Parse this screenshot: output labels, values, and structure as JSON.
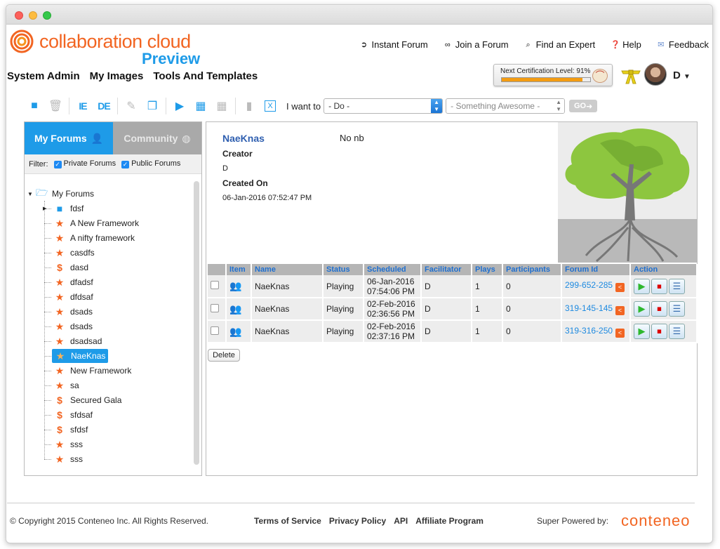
{
  "brand": {
    "name": "collaboration cloud",
    "sub": "Preview"
  },
  "topnav": [
    {
      "label": "Instant Forum",
      "icon": "play-circle-icon"
    },
    {
      "label": "Join a Forum",
      "icon": "link-icon"
    },
    {
      "label": "Find an Expert",
      "icon": "search-icon"
    },
    {
      "label": "Help",
      "icon": "help-icon"
    },
    {
      "label": "Feedback",
      "icon": "envelope-icon"
    }
  ],
  "mainmenu": [
    "System Admin",
    "My Images",
    "Tools And Templates"
  ],
  "certification": {
    "label": "Next Certification Level: 91%",
    "progress": 0.91
  },
  "user": {
    "name": "D"
  },
  "toolbar": {
    "ie": "IE",
    "de": "DE",
    "iwant_label": "I want to",
    "do_select": "- Do -",
    "something_select": "- Something Awesome -",
    "go": "GO"
  },
  "left": {
    "tab_my": "My Forums",
    "tab_community": "Community",
    "filter_label": "Filter:",
    "filter_private": "Private Forums",
    "filter_public": "Public Forums",
    "root": "My Forums",
    "items": [
      {
        "label": "fdsf",
        "type": "folder"
      },
      {
        "label": "A New Framework",
        "type": "star"
      },
      {
        "label": "A nifty framework",
        "type": "star"
      },
      {
        "label": "casdfs",
        "type": "star"
      },
      {
        "label": "dasd",
        "type": "dollar"
      },
      {
        "label": "dfadsf",
        "type": "star"
      },
      {
        "label": "dfdsaf",
        "type": "star"
      },
      {
        "label": "dsads",
        "type": "star"
      },
      {
        "label": "dsads",
        "type": "star"
      },
      {
        "label": "dsadsad",
        "type": "star"
      },
      {
        "label": "NaeKnas",
        "type": "star",
        "selected": true
      },
      {
        "label": "New Framework",
        "type": "star"
      },
      {
        "label": "sa",
        "type": "star"
      },
      {
        "label": "Secured Gala",
        "type": "dollar"
      },
      {
        "label": "sfdsaf",
        "type": "dollar"
      },
      {
        "label": "sfdsf",
        "type": "dollar"
      },
      {
        "label": "sss",
        "type": "star"
      },
      {
        "label": "sss",
        "type": "star"
      }
    ]
  },
  "detail": {
    "title": "NaeKnas",
    "description": "No nb",
    "creator_label": "Creator",
    "creator": "D",
    "created_label": "Created On",
    "created": "06-Jan-2016 07:52:47 PM"
  },
  "table": {
    "columns": [
      "",
      "Item",
      "Name",
      "Status",
      "Scheduled",
      "Facilitator",
      "Plays",
      "Participants",
      "Forum Id",
      "Action"
    ],
    "rows": [
      {
        "name": "NaeKnas",
        "status": "Playing",
        "date": "06-Jan-2016",
        "time": "07:54:06 PM",
        "facilitator": "D",
        "plays": "1",
        "participants": "0",
        "forum_id": "299-652-285"
      },
      {
        "name": "NaeKnas",
        "status": "Playing",
        "date": "02-Feb-2016",
        "time": "02:36:56 PM",
        "facilitator": "D",
        "plays": "1",
        "participants": "0",
        "forum_id": "319-145-145"
      },
      {
        "name": "NaeKnas",
        "status": "Playing",
        "date": "02-Feb-2016",
        "time": "02:37:16 PM",
        "facilitator": "D",
        "plays": "1",
        "participants": "0",
        "forum_id": "319-316-250"
      }
    ],
    "delete_label": "Delete"
  },
  "footer": {
    "copyright": "© Copyright 2015 Conteneo Inc. All Rights Reserved.",
    "links": [
      "Terms of Service",
      "Privacy Policy",
      "API",
      "Affiliate Program"
    ],
    "powered": "Super Powered by:",
    "powered_brand": "conteneo"
  },
  "colors": {
    "accent": "#1e9be8",
    "brand": "#f26522"
  }
}
